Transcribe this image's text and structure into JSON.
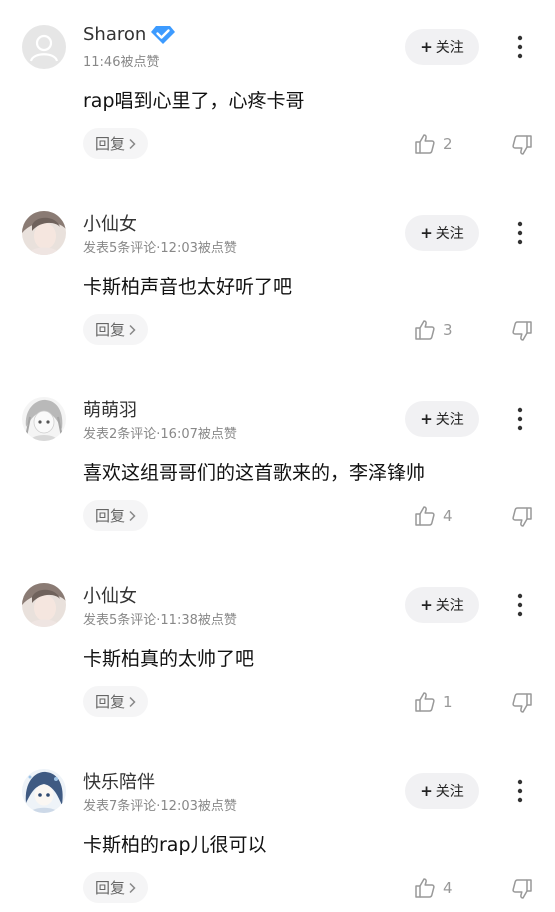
{
  "comments": [
    {
      "username": "Sharon",
      "verified": true,
      "meta": "11:46被点赞",
      "follow_label": "关注",
      "text": "rap唱到心里了，心疼卡哥",
      "reply_label": "回复",
      "likes": "2",
      "avatar": "default-avatar",
      "icons": {
        "verified": "verified-diamond-icon",
        "more": "more-vertical-icon",
        "like": "thumb-up-icon",
        "dislike": "thumb-down-icon"
      },
      "colors": {
        "verified": "#3d9bff"
      }
    },
    {
      "username": "小仙女",
      "verified": false,
      "meta": "发表5条评论·12:03被点赞",
      "follow_label": "关注",
      "text": "卡斯柏声音也太好听了吧",
      "reply_label": "回复",
      "likes": "3",
      "avatar": "user-photo-avatar"
    },
    {
      "username": "萌萌羽",
      "verified": false,
      "meta": "发表2条评论·16:07被点赞",
      "follow_label": "关注",
      "text": "喜欢这组哥哥们的这首歌来的，李泽锋帅",
      "reply_label": "回复",
      "likes": "4",
      "avatar": "anime-avatar"
    },
    {
      "username": "小仙女",
      "verified": false,
      "meta": "发表5条评论·11:38被点赞",
      "follow_label": "关注",
      "text": "卡斯柏真的太帅了吧",
      "reply_label": "回复",
      "likes": "1",
      "avatar": "user-photo-avatar"
    },
    {
      "username": "快乐陪伴",
      "verified": false,
      "meta": "发表7条评论·12:03被点赞",
      "follow_label": "关注",
      "text": "卡斯柏的rap儿很可以",
      "reply_label": "回复",
      "likes": "4",
      "avatar": "anime-blue-avatar"
    }
  ]
}
